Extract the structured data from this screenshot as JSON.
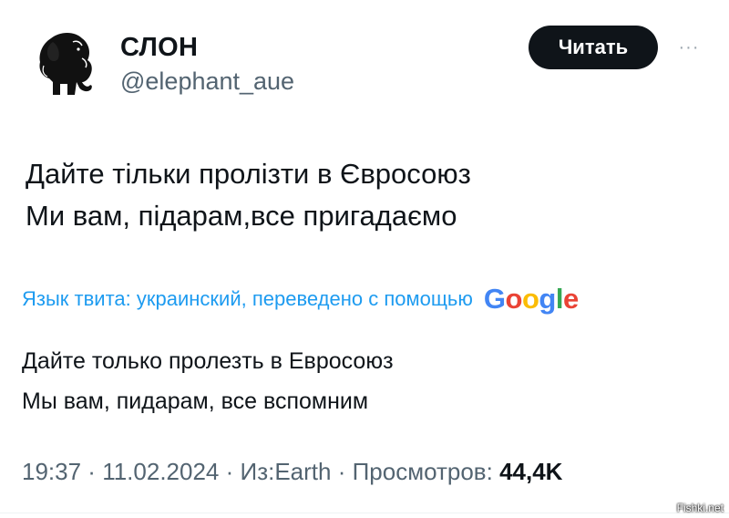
{
  "header": {
    "avatar_icon": "elephant-avatar-icon",
    "display_name": "СЛОН",
    "handle": "@elephant_aue",
    "follow_label": "Читать",
    "more_icon": "more-dots-icon",
    "more_glyph": "···"
  },
  "tweet": {
    "lines": [
      "Дайте тільки пролізти в Євросоюз",
      "Ми вам, підарам,все пригадаємо"
    ]
  },
  "translation": {
    "label": "Язык твита: украинский, переведено с помощью",
    "provider": "Google",
    "lines": [
      "Дайте только пролезть в Евросоюз",
      "Мы вам, пидарам, все вспомним"
    ]
  },
  "meta": {
    "time": "19:37",
    "date": "11.02.2024",
    "source": "Из:Earth",
    "views_label": "Просмотров:",
    "views_count": "44,4K",
    "separator": " · "
  },
  "watermark": "Fishki.net",
  "colors": {
    "accent_link": "#1d9bf0",
    "text_primary": "#0f1419",
    "text_secondary": "#536471",
    "button_bg": "#0f1419",
    "google_blue": "#4285f4",
    "google_red": "#ea4335",
    "google_yellow": "#fbbc05",
    "google_green": "#34a853"
  }
}
